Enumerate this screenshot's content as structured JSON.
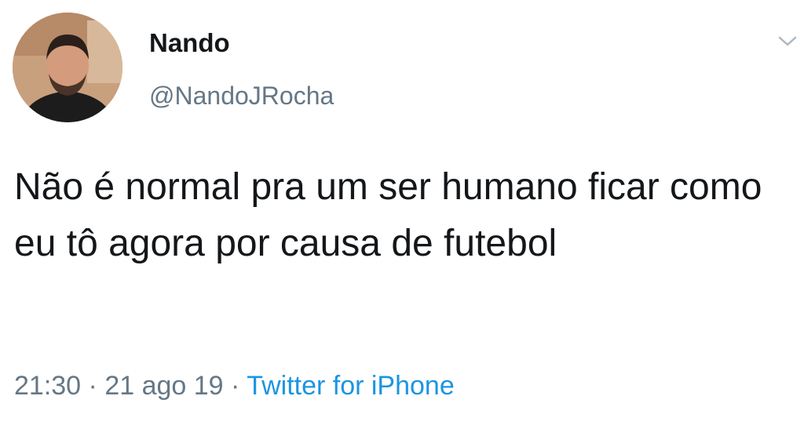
{
  "tweet": {
    "display_name": "Nando",
    "handle": "@NandoJRocha",
    "text": "Não é normal pra um ser humano ficar como eu tô agora por causa de futebol",
    "time": "21:30",
    "separator": " · ",
    "date": "21 ago 19",
    "source": "Twitter for iPhone"
  },
  "icons": {
    "avatar": "profile-photo",
    "menu": "chevron-down-icon"
  },
  "colors": {
    "name": "#14171a",
    "muted": "#657786",
    "link": "#1b95e0"
  }
}
